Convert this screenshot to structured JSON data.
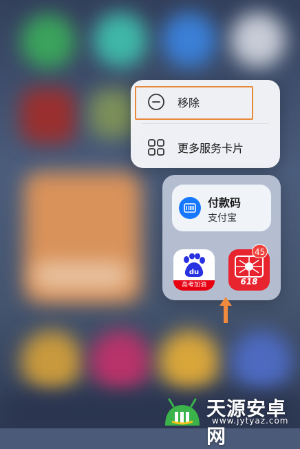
{
  "context_menu": {
    "remove_label": "移除",
    "more_cards_label": "更多服务卡片",
    "remove_icon": "minus-circle-icon",
    "more_cards_icon": "grid-icon",
    "highlight_color": "#e8893a"
  },
  "widget": {
    "payment_title": "付款码",
    "payment_app": "支付宝",
    "payment_icon": "barcode-icon",
    "apps": [
      {
        "name": "baidu",
        "badge_text": "高考加油",
        "logo_text": "du"
      },
      {
        "name": "pinduoduo",
        "label": "618",
        "notification_count": "45"
      }
    ]
  },
  "annotation": {
    "arrow_color": "#f08a3c"
  },
  "watermark": {
    "title": "天源安卓网",
    "url": "www.jytyaz.com"
  }
}
